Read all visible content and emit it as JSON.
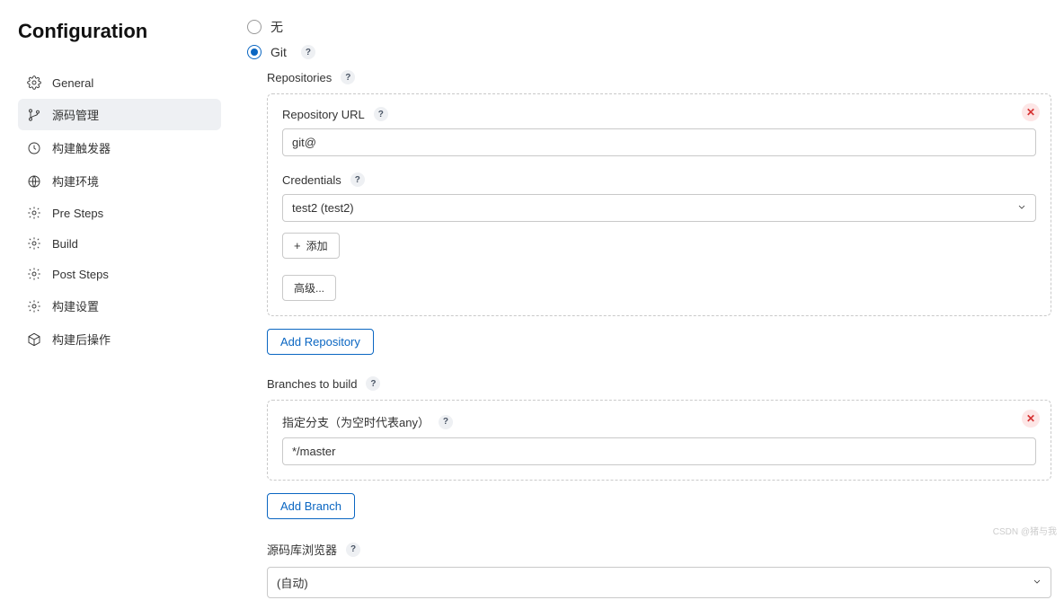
{
  "page": {
    "title": "Configuration"
  },
  "nav": {
    "items": [
      {
        "key": "general",
        "label": "General"
      },
      {
        "key": "scm",
        "label": "源码管理"
      },
      {
        "key": "triggers",
        "label": "构建触发器"
      },
      {
        "key": "env",
        "label": "构建环境"
      },
      {
        "key": "presteps",
        "label": "Pre Steps"
      },
      {
        "key": "build",
        "label": "Build"
      },
      {
        "key": "poststeps",
        "label": "Post Steps"
      },
      {
        "key": "buildsettings",
        "label": "构建设置"
      },
      {
        "key": "postbuild",
        "label": "构建后操作"
      }
    ]
  },
  "scm": {
    "none_label": "无",
    "git_label": "Git",
    "repositories_label": "Repositories",
    "repo": {
      "url_label": "Repository URL",
      "url_value": "git@",
      "credentials_label": "Credentials",
      "credentials_value": "test2 (test2)",
      "add_label": "添加",
      "advanced_label": "高级..."
    },
    "add_repo_btn": "Add Repository",
    "branches_label": "Branches to build",
    "branch": {
      "spec_label": "指定分支（为空时代表any）",
      "spec_value": "*/master"
    },
    "add_branch_btn": "Add Branch",
    "repo_browser_label": "源码库浏览器",
    "repo_browser_value": "(自动)"
  },
  "watermark": "CSDN @猪与我"
}
